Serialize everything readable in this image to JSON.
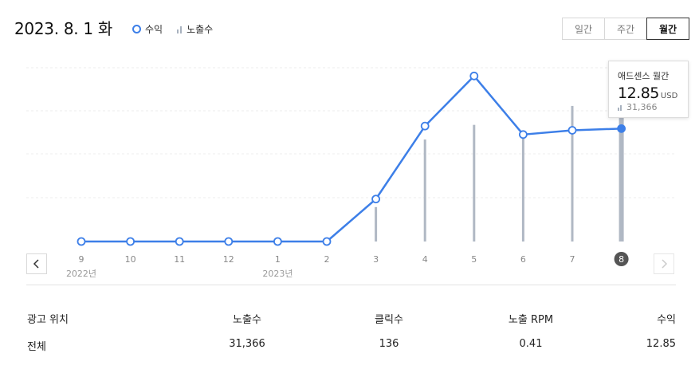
{
  "header": {
    "date": "2023. 8. 1 화",
    "legend_revenue": "수익",
    "legend_impressions": "노출수",
    "period_buttons": [
      "일간",
      "주간",
      "월간"
    ],
    "period_selected": "월간"
  },
  "tooltip": {
    "title": "애드센스 월간",
    "value": "12.85",
    "unit": "USD",
    "impressions": "31,366"
  },
  "colors": {
    "line": "#3d7fe8",
    "bars": "#b0b8c4",
    "grid": "#ececec"
  },
  "chart_data": {
    "type": "line",
    "categories": [
      "9",
      "10",
      "11",
      "12",
      "1",
      "2",
      "3",
      "4",
      "5",
      "6",
      "7",
      "8"
    ],
    "year_labels": [
      "2022년",
      "2023년"
    ],
    "series": [
      {
        "name": "수익",
        "values": [
          0,
          0,
          0,
          0,
          0,
          0,
          5.0,
          13.6,
          19.5,
          12.6,
          13.1,
          13.3
        ]
      },
      {
        "name": "노출수",
        "values": [
          0,
          0,
          0,
          0,
          0,
          0,
          8000,
          23700,
          27100,
          24000,
          31500,
          31366
        ]
      }
    ],
    "selected_index": 11,
    "grid": true
  },
  "table": {
    "headers": [
      "광고 위치",
      "노출수",
      "클릭수",
      "노출 RPM",
      "수익"
    ],
    "rows": [
      [
        "전체",
        "31,366",
        "136",
        "0.41",
        "12.85"
      ]
    ]
  },
  "icons": {
    "prev": "chevron-left-icon",
    "next": "chevron-right-icon"
  }
}
